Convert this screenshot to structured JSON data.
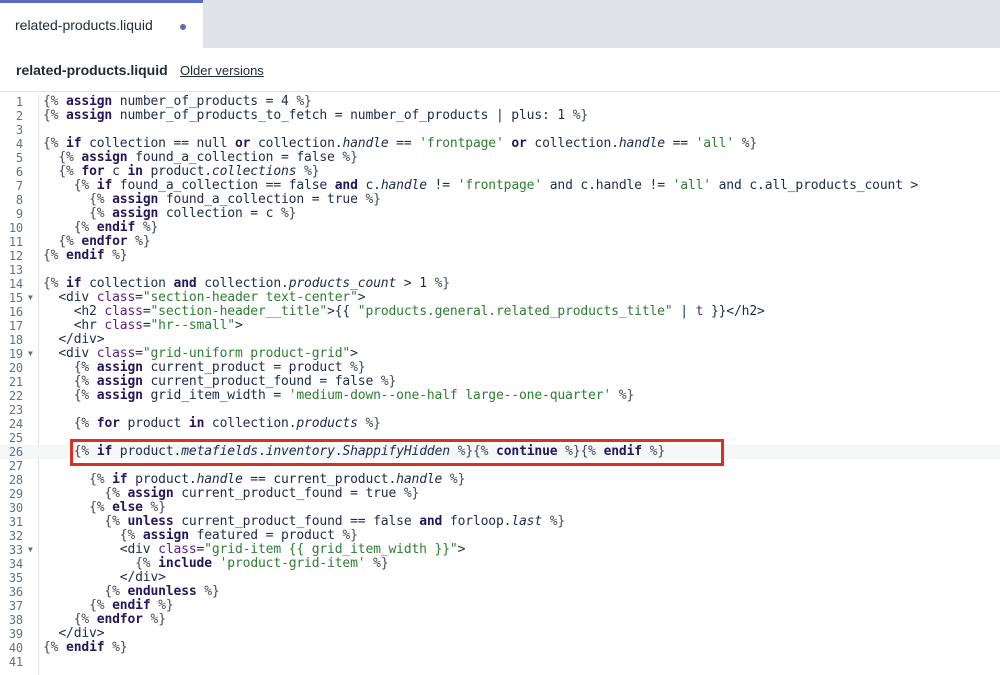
{
  "tab": {
    "label": "related-products.liquid",
    "accent": "#5c6ac4"
  },
  "header": {
    "file_name": "related-products.liquid",
    "older_versions": "Older versions"
  },
  "colors": {
    "highlight_border": "#d93025",
    "keyword": "#23175c",
    "string": "#2e7d32"
  },
  "code_lines": [
    {
      "n": "1",
      "html": "<span class=dl>{%</span> <span class=kw>assign</span> number_of_products = 4 <span class=dl>%}</span>"
    },
    {
      "n": "2",
      "html": "<span class=dl>{%</span> <span class=kw>assign</span> number_of_products_to_fetch = number_of_products | plus: 1 <span class=dl>%}</span>"
    },
    {
      "n": "3",
      "html": ""
    },
    {
      "n": "4",
      "html": "<span class=dl>{%</span> <span class=kw>if</span> collection == null <span class=kw>or</span> collection.<span class=pr>handle</span> == <span class=st>'frontpage'</span> <span class=kw>or</span> collection.<span class=pr>handle</span> == <span class=st>'all'</span> <span class=dl>%}</span>"
    },
    {
      "n": "5",
      "html": "  <span class=dl>{%</span> <span class=kw>assign</span> found_a_collection = false <span class=dl>%}</span>"
    },
    {
      "n": "6",
      "html": "  <span class=dl>{%</span> <span class=kw>for</span> c <span class=kw>in</span> product.<span class=pr>collections</span> <span class=dl>%}</span>"
    },
    {
      "n": "7",
      "html": "    <span class=dl>{%</span> <span class=kw>if</span> found_a_collection == false <span class=kw>and</span> c.<span class=pr>handle</span> != <span class=st>'frontpage'</span> and c.handle != <span class=st>'all'</span> and c.all_products_count &gt;"
    },
    {
      "n": "8",
      "html": "      <span class=dl>{%</span> <span class=kw>assign</span> found_a_collection = true <span class=dl>%}</span>"
    },
    {
      "n": "9",
      "html": "      <span class=dl>{%</span> <span class=kw>assign</span> collection = c <span class=dl>%}</span>"
    },
    {
      "n": "10",
      "html": "    <span class=dl>{%</span> <span class=kw>endif</span> <span class=dl>%}</span>"
    },
    {
      "n": "11",
      "html": "  <span class=dl>{%</span> <span class=kw>endfor</span> <span class=dl>%}</span>"
    },
    {
      "n": "12",
      "html": "<span class=dl>{%</span> <span class=kw>endif</span> <span class=dl>%}</span>"
    },
    {
      "n": "13",
      "html": ""
    },
    {
      "n": "14",
      "html": "<span class=dl>{%</span> <span class=kw>if</span> collection <span class=kw>and</span> collection.<span class=pr>products_count</span> &gt; 1 <span class=dl>%}</span>"
    },
    {
      "n": "15",
      "fold": true,
      "html": "  &lt;div <span class=at>class</span>=<span class=st>\"section-header text-center\"</span>&gt;"
    },
    {
      "n": "16",
      "html": "    &lt;h2 <span class=at>class</span>=<span class=st>\"section-header__title\"</span>&gt;{{ <span class=st>\"products.general.related_products_title\"</span> | <span class=at>t</span> }}&lt;/h2&gt;"
    },
    {
      "n": "17",
      "html": "    &lt;hr <span class=at>class</span>=<span class=st>\"hr--small\"</span>&gt;"
    },
    {
      "n": "18",
      "html": "  &lt;/div&gt;"
    },
    {
      "n": "19",
      "fold": true,
      "html": "  &lt;div <span class=at>class</span>=<span class=st>\"grid-uniform product-grid\"</span>&gt;"
    },
    {
      "n": "20",
      "html": "    <span class=dl>{%</span> <span class=kw>assign</span> current_product = product <span class=dl>%}</span>"
    },
    {
      "n": "21",
      "html": "    <span class=dl>{%</span> <span class=kw>assign</span> current_product_found = false <span class=dl>%}</span>"
    },
    {
      "n": "22",
      "html": "    <span class=dl>{%</span> <span class=kw>assign</span> grid_item_width = <span class=st>'medium-down--one-half large--one-quarter'</span> <span class=dl>%}</span>"
    },
    {
      "n": "23",
      "html": ""
    },
    {
      "n": "24",
      "html": "    <span class=dl>{%</span> <span class=kw>for</span> product <span class=kw>in</span> collection.<span class=pr>products</span> <span class=dl>%}</span>"
    },
    {
      "n": "25",
      "html": ""
    },
    {
      "n": "26",
      "active": true,
      "html": "    <span class=dl>{%</span> <span class=kw>if</span> product.<span class=pr>metafields</span>.<span class=pr>inventory</span>.<span class=pr>ShappifyHidden</span> <span class=dl>%}{%</span> <span class=kw>continue</span> <span class=dl>%}{%</span> <span class=kw>endif</span> <span class=dl>%}</span>"
    },
    {
      "n": "27",
      "html": ""
    },
    {
      "n": "28",
      "html": "      <span class=dl>{%</span> <span class=kw>if</span> product.<span class=pr>handle</span> == current_product.<span class=pr>handle</span> <span class=dl>%}</span>"
    },
    {
      "n": "29",
      "html": "        <span class=dl>{%</span> <span class=kw>assign</span> current_product_found = true <span class=dl>%}</span>"
    },
    {
      "n": "30",
      "html": "      <span class=dl>{%</span> <span class=kw>else</span> <span class=dl>%}</span>"
    },
    {
      "n": "31",
      "html": "        <span class=dl>{%</span> <span class=kw>unless</span> current_product_found == false <span class=kw>and</span> forloop.<span class=pr>last</span> <span class=dl>%}</span>"
    },
    {
      "n": "32",
      "html": "          <span class=dl>{%</span> <span class=kw>assign</span> featured = product <span class=dl>%}</span>"
    },
    {
      "n": "33",
      "fold": true,
      "html": "          &lt;div <span class=at>class</span>=<span class=st>\"grid-item {{ grid_item_width }}\"</span>&gt;"
    },
    {
      "n": "34",
      "html": "            <span class=dl>{%</span> <span class=kw>include</span> <span class=st>'product-grid-item'</span> <span class=dl>%}</span>"
    },
    {
      "n": "35",
      "html": "          &lt;/div&gt;"
    },
    {
      "n": "36",
      "html": "        <span class=dl>{%</span> <span class=kw>endunless</span> <span class=dl>%}</span>"
    },
    {
      "n": "37",
      "html": "      <span class=dl>{%</span> <span class=kw>endif</span> <span class=dl>%}</span>"
    },
    {
      "n": "38",
      "html": "    <span class=dl>{%</span> <span class=kw>endfor</span> <span class=dl>%}</span>"
    },
    {
      "n": "39",
      "html": "  &lt;/div&gt;"
    },
    {
      "n": "40",
      "html": "<span class=dl>{%</span> <span class=kw>endif</span> <span class=dl>%}</span>"
    },
    {
      "n": "41",
      "html": ""
    }
  ]
}
